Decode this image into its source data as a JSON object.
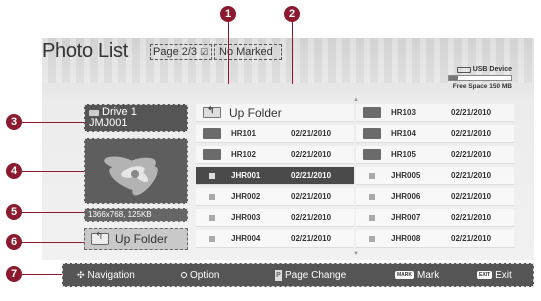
{
  "header": {
    "title": "Photo List",
    "page_indicator": "Page 2/3",
    "marked_status": "No Marked"
  },
  "usb": {
    "device_label": "USB Device",
    "free_space": "Free Space 150 MB",
    "used_fraction": 0.15
  },
  "preview": {
    "drive_name": "Drive 1",
    "folder_name": "JMJ001",
    "image_info": "1366x768, 125KB",
    "up_folder_label": "Up Folder"
  },
  "grid": {
    "items": [
      {
        "type": "upfolder",
        "name": "Up Folder",
        "date": ""
      },
      {
        "type": "folder",
        "name": "HR103",
        "date": "02/21/2010"
      },
      {
        "type": "folder",
        "name": "HR101",
        "date": "02/21/2010"
      },
      {
        "type": "folder",
        "name": "HR104",
        "date": "02/21/2010"
      },
      {
        "type": "folder",
        "name": "HR102",
        "date": "02/21/2010"
      },
      {
        "type": "folder",
        "name": "HR105",
        "date": "02/21/2010"
      },
      {
        "type": "file",
        "name": "JHR001",
        "date": "02/21/2010",
        "selected": true
      },
      {
        "type": "file",
        "name": "JHR005",
        "date": "02/21/2010"
      },
      {
        "type": "file",
        "name": "JHR002",
        "date": "02/21/2010"
      },
      {
        "type": "file",
        "name": "JHR006",
        "date": "02/21/2010"
      },
      {
        "type": "file",
        "name": "JHR003",
        "date": "02/21/2010"
      },
      {
        "type": "file",
        "name": "JHR007",
        "date": "02/21/2010"
      },
      {
        "type": "file",
        "name": "JHR004",
        "date": "02/21/2010"
      },
      {
        "type": "file",
        "name": "JHR008",
        "date": "02/21/2010"
      }
    ]
  },
  "bottom_bar": {
    "navigation": "Navigation",
    "option": "Option",
    "page_change": "Page Change",
    "mark_key": "MARK",
    "mark": "Mark",
    "exit_key": "EXIT",
    "exit": "Exit"
  },
  "callouts": {
    "c1": "1",
    "c2": "2",
    "c3": "3",
    "c4": "4",
    "c5": "5",
    "c6": "6",
    "c7": "7"
  },
  "colors": {
    "callout": "#8b1a2e",
    "selected_row": "#4a4a4a",
    "bar": "#555555"
  }
}
